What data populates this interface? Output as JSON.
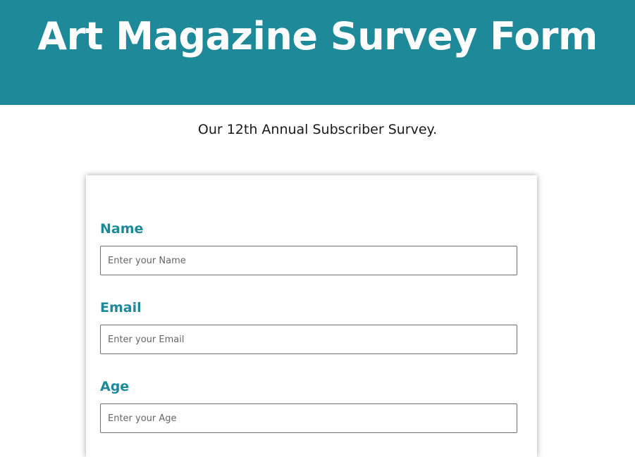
{
  "header": {
    "title": "Art Magazine Survey Form"
  },
  "intro": {
    "subtitle": "Our 12th Annual Subscriber Survey."
  },
  "form": {
    "fields": [
      {
        "label": "Name",
        "placeholder": "Enter your Name"
      },
      {
        "label": "Email",
        "placeholder": "Enter your Email"
      },
      {
        "label": "Age",
        "placeholder": "Enter your Age"
      }
    ]
  },
  "colors": {
    "accent": "#1e8999",
    "header_background": "#1e8999",
    "header_text": "#ffffff"
  }
}
